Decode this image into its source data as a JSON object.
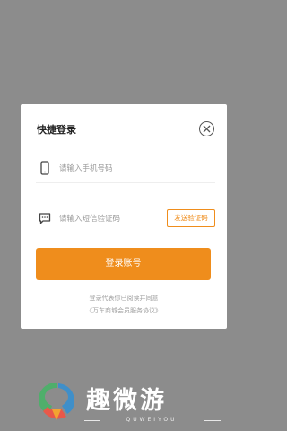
{
  "modal": {
    "title": "快捷登录",
    "phone_placeholder": "请输入手机号码",
    "code_placeholder": "请输入短信验证码",
    "send_code_label": "发送验证码",
    "login_label": "登录账号",
    "agreement_line1": "登录代表你已阅读并同意",
    "agreement_line2": "《万车商城会员服务协议》"
  },
  "watermark": {
    "name": "趣微游",
    "subtitle": "QUWEIYOU"
  },
  "colors": {
    "accent": "#ef8d1c",
    "overlay": "#8c8c8c"
  },
  "icons": {
    "close": "close-circle-icon",
    "phone": "phone-icon",
    "message": "message-icon"
  }
}
